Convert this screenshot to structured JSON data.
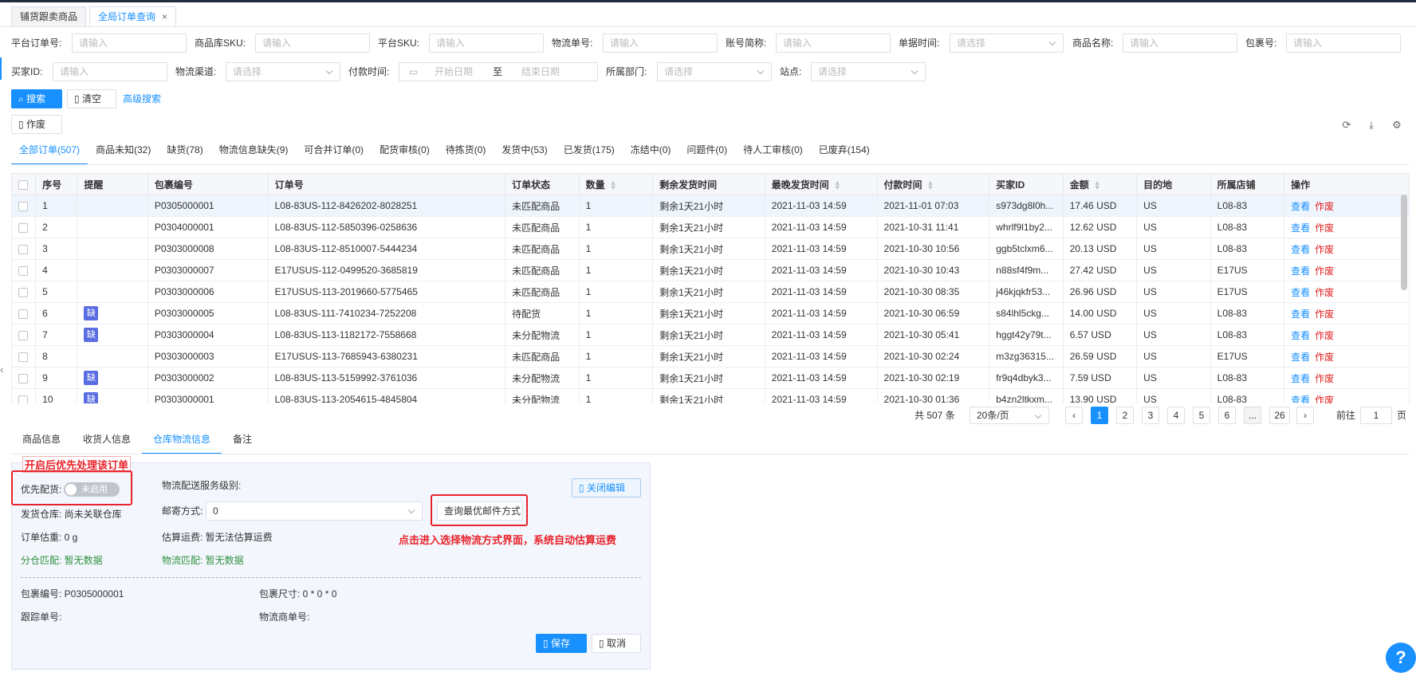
{
  "top_tabs": [
    {
      "label": "铺货跟卖商品"
    },
    {
      "label": "全局订单查询",
      "close": "×"
    }
  ],
  "filters": {
    "row1": [
      {
        "label": "平台订单号:",
        "placeholder": "请输入"
      },
      {
        "label": "商品库SKU:",
        "placeholder": "请输入"
      },
      {
        "label": "平台SKU:",
        "placeholder": "请输入"
      },
      {
        "label": "物流单号:",
        "placeholder": "请输入"
      },
      {
        "label": "账号简称:",
        "placeholder": "请输入"
      },
      {
        "label": "单据时间:",
        "placeholder": "请选择"
      },
      {
        "label": "商品名称:",
        "placeholder": "请输入"
      },
      {
        "label": "包裹号:",
        "placeholder": "请输入"
      }
    ],
    "row2": [
      {
        "label": "买家ID:",
        "placeholder": "请输入"
      },
      {
        "label": "物流渠道:",
        "placeholder": "请选择"
      },
      {
        "label": "付款时间:",
        "start": "开始日期",
        "sep": "至",
        "end": "结束日期"
      },
      {
        "label": "所属部门:",
        "placeholder": "请选择"
      },
      {
        "label": "站点:",
        "placeholder": "请选择"
      }
    ]
  },
  "actions": {
    "search": "搜索",
    "clear": "清空",
    "advanced": "高级搜索",
    "void": "作废"
  },
  "icons": {
    "refresh": "refresh-icon",
    "download": "download-icon",
    "settings": "gear-icon"
  },
  "status_tabs": [
    "全部订单(507)",
    "商品未知(32)",
    "缺货(78)",
    "物流信息缺失(9)",
    "可合并订单(0)",
    "配货审核(0)",
    "待拣货(0)",
    "发货中(53)",
    "已发货(175)",
    "冻结中(0)",
    "问题件(0)",
    "待人工审核(0)",
    "已废弃(154)"
  ],
  "table": {
    "headers": [
      "",
      "序号",
      "提醒",
      "包裹编号",
      "订单号",
      "订单状态",
      "数量",
      "剩余发货时间",
      "最晚发货时间",
      "付款时间",
      "买家ID",
      "金额",
      "目的地",
      "所属店铺",
      "操作"
    ],
    "view": "查看",
    "void": "作废",
    "rows": [
      {
        "no": "1",
        "remind": "",
        "pkg": "P0305000001",
        "order": "L08-83US-112-8426202-8028251",
        "status": "未匹配商品",
        "qty": "1",
        "remain": "剩余1天21小时",
        "latest": "2021-11-03 14:59",
        "pay": "2021-11-01 07:03",
        "buyer": "s973dg8l0h...",
        "amount": "17.46 USD",
        "dest": "US",
        "shop": "L08-83"
      },
      {
        "no": "2",
        "remind": "",
        "pkg": "P0304000001",
        "order": "L08-83US-112-5850396-0258636",
        "status": "未匹配商品",
        "qty": "1",
        "remain": "剩余1天21小时",
        "latest": "2021-11-03 14:59",
        "pay": "2021-10-31 11:41",
        "buyer": "whrlf9l1by2...",
        "amount": "12.62 USD",
        "dest": "US",
        "shop": "L08-83"
      },
      {
        "no": "3",
        "remind": "",
        "pkg": "P0303000008",
        "order": "L08-83US-112-8510007-5444234",
        "status": "未匹配商品",
        "qty": "1",
        "remain": "剩余1天21小时",
        "latest": "2021-11-03 14:59",
        "pay": "2021-10-30 10:56",
        "buyer": "ggb5tclxm6...",
        "amount": "20.13 USD",
        "dest": "US",
        "shop": "L08-83"
      },
      {
        "no": "4",
        "remind": "",
        "pkg": "P0303000007",
        "order": "E17USUS-112-0499520-3685819",
        "status": "未匹配商品",
        "qty": "1",
        "remain": "剩余1天21小时",
        "latest": "2021-11-03 14:59",
        "pay": "2021-10-30 10:43",
        "buyer": "n88sf4f9m...",
        "amount": "27.42 USD",
        "dest": "US",
        "shop": "E17US"
      },
      {
        "no": "5",
        "remind": "",
        "pkg": "P0303000006",
        "order": "E17USUS-113-2019660-5775465",
        "status": "未匹配商品",
        "qty": "1",
        "remain": "剩余1天21小时",
        "latest": "2021-11-03 14:59",
        "pay": "2021-10-30 08:35",
        "buyer": "j46kjqkfr53...",
        "amount": "26.96 USD",
        "dest": "US",
        "shop": "E17US"
      },
      {
        "no": "6",
        "remind": "缺",
        "pkg": "P0303000005",
        "order": "L08-83US-111-7410234-7252208",
        "status": "待配货",
        "qty": "1",
        "remain": "剩余1天21小时",
        "latest": "2021-11-03 14:59",
        "pay": "2021-10-30 06:59",
        "buyer": "s84lhl5ckg...",
        "amount": "14.00 USD",
        "dest": "US",
        "shop": "L08-83"
      },
      {
        "no": "7",
        "remind": "缺",
        "pkg": "P0303000004",
        "order": "L08-83US-113-1182172-7558668",
        "status": "未分配物流",
        "qty": "1",
        "remain": "剩余1天21小时",
        "latest": "2021-11-03 14:59",
        "pay": "2021-10-30 05:41",
        "buyer": "hggt42y79t...",
        "amount": "6.57 USD",
        "dest": "US",
        "shop": "L08-83"
      },
      {
        "no": "8",
        "remind": "",
        "pkg": "P0303000003",
        "order": "E17USUS-113-7685943-6380231",
        "status": "未匹配商品",
        "qty": "1",
        "remain": "剩余1天21小时",
        "latest": "2021-11-03 14:59",
        "pay": "2021-10-30 02:24",
        "buyer": "m3zg36315...",
        "amount": "26.59 USD",
        "dest": "US",
        "shop": "E17US"
      },
      {
        "no": "9",
        "remind": "缺",
        "pkg": "P0303000002",
        "order": "L08-83US-113-5159992-3761036",
        "status": "未分配物流",
        "qty": "1",
        "remain": "剩余1天21小时",
        "latest": "2021-11-03 14:59",
        "pay": "2021-10-30 02:19",
        "buyer": "fr9q4dbyk3...",
        "amount": "7.59 USD",
        "dest": "US",
        "shop": "L08-83"
      },
      {
        "no": "10",
        "remind": "缺",
        "pkg": "P0303000001",
        "order": "L08-83US-113-2054615-4845804",
        "status": "未分配物流",
        "qty": "1",
        "remain": "剩余1天21小时",
        "latest": "2021-11-03 14:59",
        "pay": "2021-10-30 01:36",
        "buyer": "b4zn2ltkxm...",
        "amount": "13.90 USD",
        "dest": "US",
        "shop": "L08-83"
      }
    ]
  },
  "pagination": {
    "total": "共 507 条",
    "page_size": "20条/页",
    "prev": "‹",
    "pages": [
      "1",
      "2",
      "3",
      "4",
      "5",
      "6",
      "...",
      "26"
    ],
    "next": "›",
    "goto_label": "前往",
    "goto_value": "1",
    "goto_suffix": "页"
  },
  "detail_tabs": [
    "商品信息",
    "收货人信息",
    "仓库物流信息",
    "备注"
  ],
  "detail": {
    "priority_label": "优先配货:",
    "priority_toggle": "未启用",
    "warehouse": "发货仓库: 尚未关联仓库",
    "weight": "订单估重: 0 g",
    "split": "分仓匹配: 暂无数据",
    "service_level": "物流配送服务级别:",
    "mail_label": "邮寄方式:",
    "mail_value": "0",
    "fee": "估算运费: 暂无法估算运费",
    "logistics_match": "物流匹配: 暂无数据",
    "query_btn": "查询最优邮件方式",
    "close_edit": "关闭编辑",
    "pkg_no": "包裹编号: P0305000001",
    "pkg_size": "包裹尺寸: 0 * 0 * 0",
    "tracking": "跟踪单号:",
    "carrier": "物流商单号:",
    "save": "保存",
    "cancel": "取消"
  },
  "annotations": {
    "priority_note": "开启后优先处理该订单",
    "query_note": "点击进入选择物流方式界面，系统自动估算运费"
  },
  "help": "?"
}
